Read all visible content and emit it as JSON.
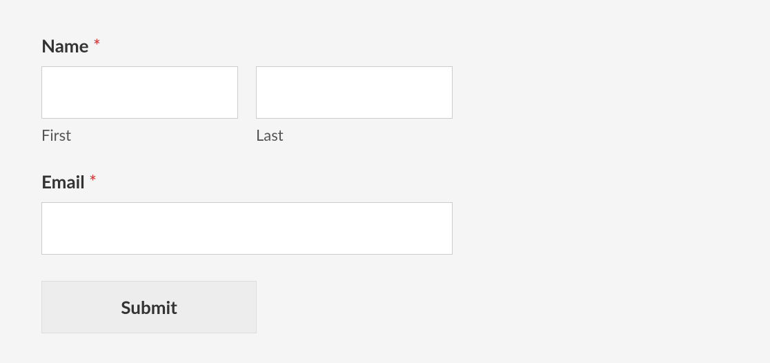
{
  "form": {
    "name": {
      "label": "Name",
      "required_mark": "*",
      "first": {
        "sublabel": "First",
        "value": ""
      },
      "last": {
        "sublabel": "Last",
        "value": ""
      }
    },
    "email": {
      "label": "Email",
      "required_mark": "*",
      "value": ""
    },
    "submit": {
      "label": "Submit"
    }
  }
}
